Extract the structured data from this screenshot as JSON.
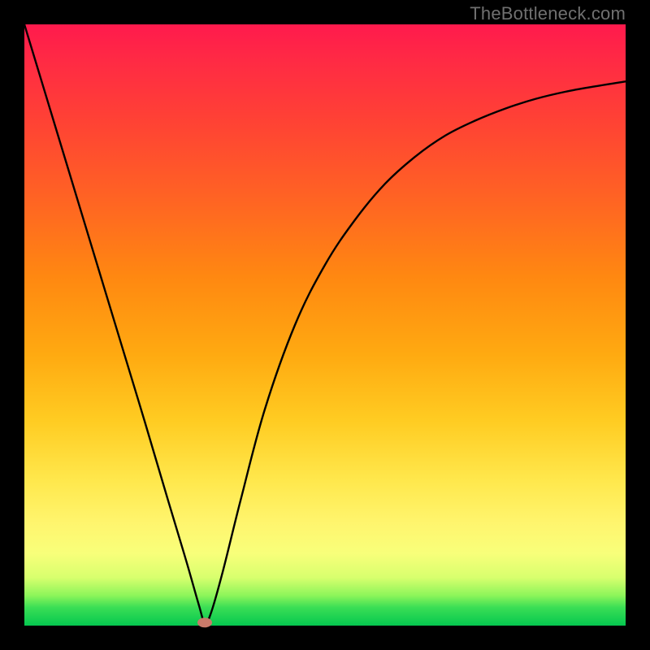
{
  "watermark": "TheBottleneck.com",
  "chart_data": {
    "type": "line",
    "title": "",
    "xlabel": "",
    "ylabel": "",
    "xlim": [
      0,
      1
    ],
    "ylim": [
      0,
      1
    ],
    "grid": false,
    "legend": false,
    "series": [
      {
        "name": "bottleneck-curve",
        "x": [
          0.0,
          0.05,
          0.1,
          0.15,
          0.2,
          0.24,
          0.27,
          0.29,
          0.3,
          0.31,
          0.33,
          0.36,
          0.4,
          0.45,
          0.5,
          0.55,
          0.6,
          0.65,
          0.7,
          0.75,
          0.8,
          0.85,
          0.9,
          0.95,
          1.0
        ],
        "y": [
          1.0,
          0.835,
          0.67,
          0.505,
          0.34,
          0.205,
          0.105,
          0.035,
          0.005,
          0.02,
          0.09,
          0.21,
          0.36,
          0.5,
          0.6,
          0.675,
          0.735,
          0.78,
          0.815,
          0.84,
          0.86,
          0.876,
          0.888,
          0.897,
          0.905
        ]
      }
    ],
    "marker": {
      "name": "minimum-point",
      "x": 0.3,
      "y": 0.005,
      "color": "#c97a6a"
    },
    "background_gradient": {
      "type": "vertical",
      "stops": [
        {
          "pos": 0.0,
          "color": "#ff1a4d"
        },
        {
          "pos": 0.5,
          "color": "#ff9911"
        },
        {
          "pos": 0.82,
          "color": "#fff56e"
        },
        {
          "pos": 1.0,
          "color": "#05c74f"
        }
      ]
    }
  }
}
